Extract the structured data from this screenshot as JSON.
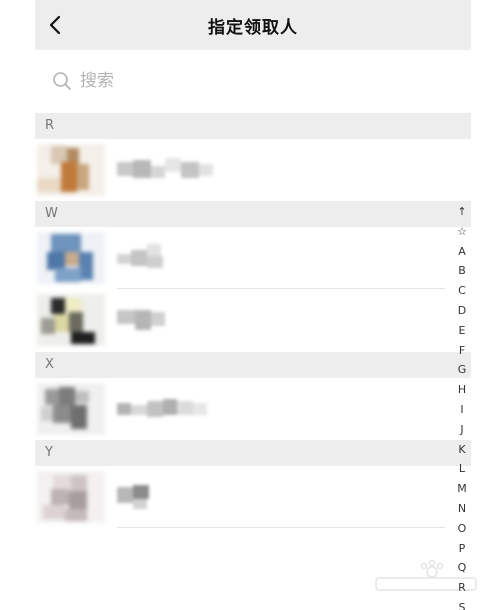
{
  "header": {
    "title": "指定领取人",
    "back_icon": "chevron-left-icon"
  },
  "search": {
    "placeholder": "搜索",
    "icon": "search-icon"
  },
  "sections": [
    {
      "letter": "R"
    },
    {
      "letter": "W"
    },
    {
      "letter": "X"
    },
    {
      "letter": "Y"
    }
  ],
  "index_bar": {
    "letters": [
      "↑",
      "☆",
      "A",
      "B",
      "C",
      "D",
      "E",
      "F",
      "G",
      "H",
      "I",
      "J",
      "K",
      "L",
      "M",
      "N",
      "O",
      "P",
      "Q",
      "R",
      "S"
    ]
  },
  "colors": {
    "header_bg": "#ededed",
    "section_bg": "#ededed",
    "divider": "#e5e5e5",
    "placeholder": "#b3b3b3"
  }
}
